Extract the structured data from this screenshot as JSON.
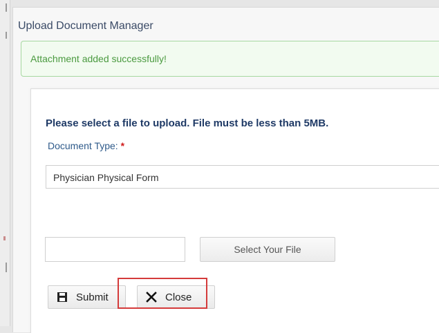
{
  "dialog": {
    "title": "Upload Document Manager",
    "alert_message": "Attachment added successfully!"
  },
  "form": {
    "instructions": "Please select a file to upload. File must be less than 5MB.",
    "document_type_label": "Document Type:",
    "required_marker": "*",
    "document_type_value": "Physician Physical Form",
    "file_name_value": "",
    "select_file_label": "Select Your File"
  },
  "actions": {
    "submit_label": "Submit",
    "close_label": "Close"
  },
  "colors": {
    "title": "#3a4a66",
    "success_text": "#4a9a3f",
    "success_border": "#a6d8a0",
    "instructions": "#1f3a66",
    "required": "#d01a1a",
    "highlight": "#d43a3a"
  },
  "icons": {
    "submit": "save-icon",
    "close": "close-icon"
  }
}
